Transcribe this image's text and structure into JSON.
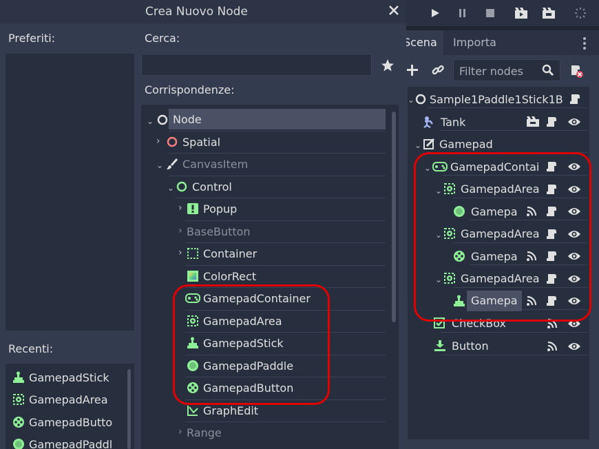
{
  "dialog": {
    "title": "Crea Nuovo Node",
    "favorites_label": "Preferiti:",
    "search_label": "Cerca:",
    "search_value": "",
    "matches_label": "Corrispondenze:",
    "recent_label": "Recenti:",
    "recent_items": [
      "GamepadStick",
      "GamepadArea",
      "GamepadButto",
      "GamepadPaddl"
    ],
    "matches": [
      {
        "label": "Node"
      },
      {
        "label": "Spatial"
      },
      {
        "label": "CanvasItem"
      },
      {
        "label": "Control"
      },
      {
        "label": "Popup"
      },
      {
        "label": "BaseButton"
      },
      {
        "label": "Container"
      },
      {
        "label": "ColorRect"
      },
      {
        "label": "GamepadContainer"
      },
      {
        "label": "GamepadArea"
      },
      {
        "label": "GamepadStick"
      },
      {
        "label": "GamepadPaddle"
      },
      {
        "label": "GamepadButton"
      },
      {
        "label": "GraphEdit"
      },
      {
        "label": "Range"
      }
    ]
  },
  "scene": {
    "tabs": [
      "Scena",
      "Importa"
    ],
    "filter_placeholder": "Filter nodes",
    "nodes": [
      {
        "label": "Sample1Paddle1Stick1B"
      },
      {
        "label": "Tank"
      },
      {
        "label": "Gamepad"
      },
      {
        "label": "GamepadContai"
      },
      {
        "label": "GamepadArea"
      },
      {
        "label": "Gamepa"
      },
      {
        "label": "GamepadArea"
      },
      {
        "label": "Gamepa"
      },
      {
        "label": "GamepadArea"
      },
      {
        "label": "Gamepa"
      },
      {
        "label": "CheckBox"
      },
      {
        "label": "Button"
      }
    ]
  },
  "colors": {
    "highlight": "#e00000",
    "control_green": "#8eef97",
    "spatial_red": "#fc7f7f",
    "canvas_blue": "#a5b7f3"
  }
}
